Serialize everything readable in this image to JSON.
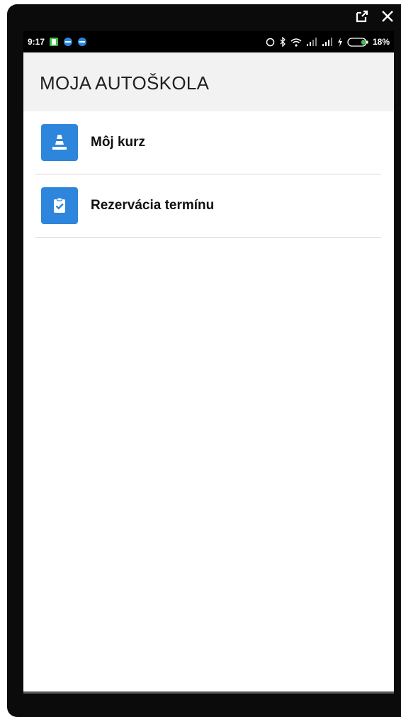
{
  "status_bar": {
    "time": "9:17",
    "battery": "18%"
  },
  "app": {
    "title": "MOJA AUTOŠKOLA"
  },
  "menu": {
    "items": [
      {
        "label": "Môj kurz",
        "icon": "traffic-cone-icon"
      },
      {
        "label": "Rezervácia termínu",
        "icon": "clipboard-check-icon"
      }
    ]
  },
  "colors": {
    "accent": "#2d86db",
    "appbar_bg": "#f2f2f2",
    "device_frame": "#0b0b0b"
  }
}
